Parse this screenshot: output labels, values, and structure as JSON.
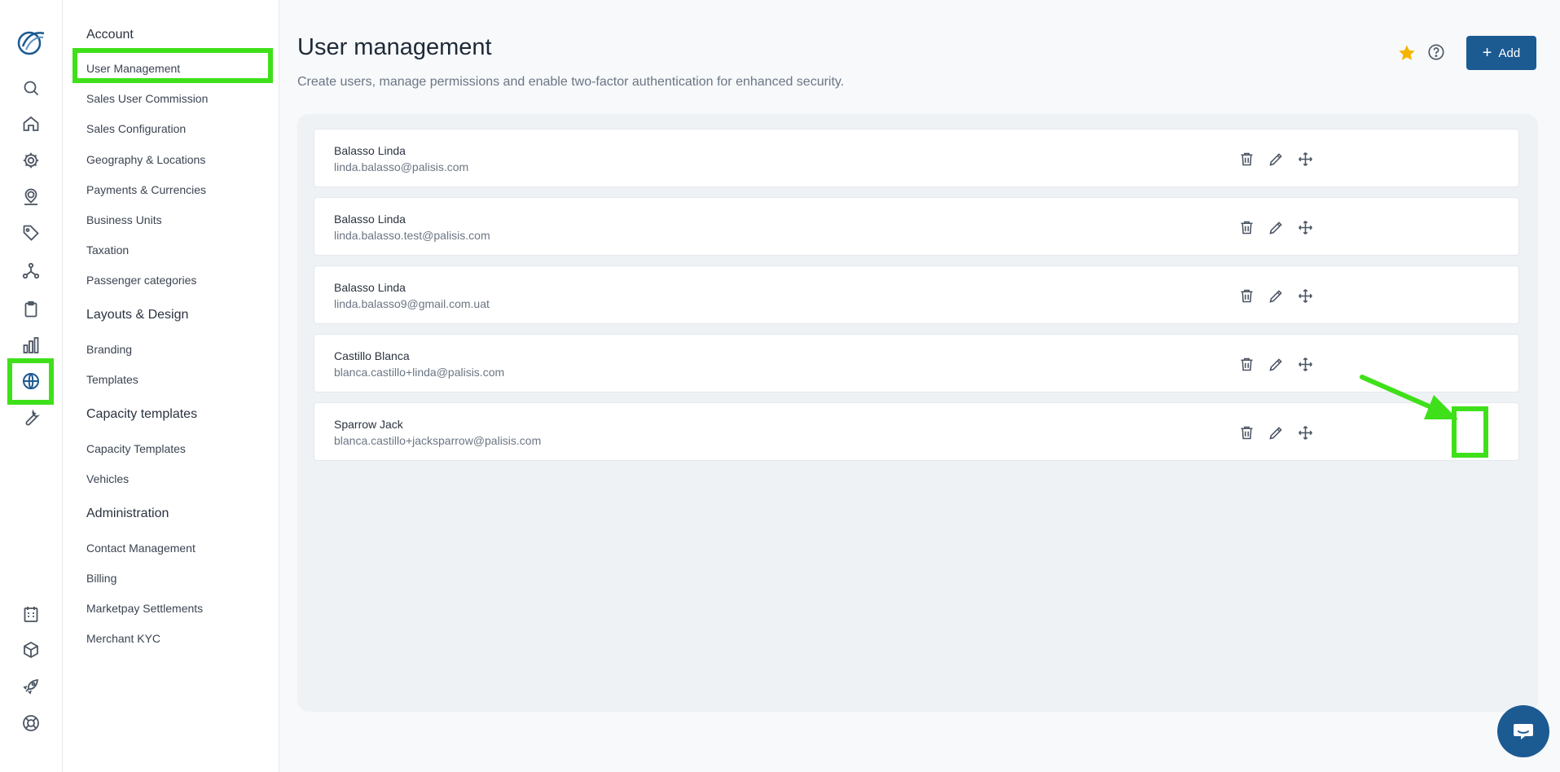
{
  "sidebar": {
    "sections": [
      {
        "title": "Account",
        "items": [
          "User Management",
          "Sales User Commission",
          "Sales Configuration",
          "Geography & Locations",
          "Payments & Currencies",
          "Business Units",
          "Taxation",
          "Passenger categories"
        ]
      },
      {
        "title": "Layouts & Design",
        "items": [
          "Branding",
          "Templates"
        ]
      },
      {
        "title": "Capacity templates",
        "items": [
          "Capacity Templates",
          "Vehicles"
        ]
      },
      {
        "title": "Administration",
        "items": [
          "Contact Management",
          "Billing",
          "Marketpay Settlements",
          "Merchant KYC"
        ]
      }
    ],
    "selected": "User Management"
  },
  "rail": {
    "icons": [
      "logo-icon",
      "search-icon",
      "home-icon",
      "gear-icon",
      "user-pin-icon",
      "tag-icon",
      "network-icon",
      "clipboard-icon",
      "bar-chart-icon",
      "globe-icon",
      "wrench-icon",
      "building-icon",
      "cube-icon",
      "rocket-icon",
      "lifebuoy-icon"
    ],
    "active": "globe-icon"
  },
  "header": {
    "title": "User management",
    "subtitle": "Create users, manage permissions and enable two-factor authentication for enhanced security.",
    "add_label": "Add"
  },
  "users": [
    {
      "name": "Balasso Linda",
      "email": "linda.balasso@palisis.com"
    },
    {
      "name": "Balasso Linda",
      "email": "linda.balasso.test@palisis.com"
    },
    {
      "name": "Balasso Linda",
      "email": "linda.balasso9@gmail.com.uat"
    },
    {
      "name": "Castillo Blanca",
      "email": "blanca.castillo+linda@palisis.com"
    },
    {
      "name": "Sparrow Jack",
      "email": "blanca.castillo+jacksparrow@palisis.com"
    }
  ],
  "colors": {
    "accent": "#1c5a92",
    "highlight": "#3fe01a",
    "star": "#f5b400"
  }
}
